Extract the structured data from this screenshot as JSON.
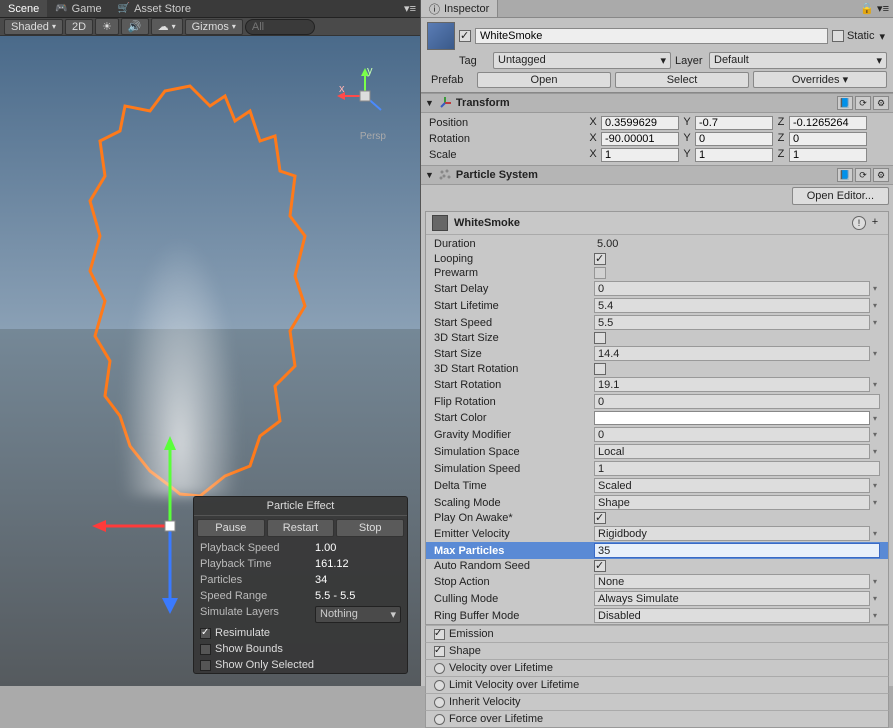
{
  "tabs": {
    "scene": "Scene",
    "game": "Game",
    "asset_store": "Asset Store"
  },
  "scene_toolbar": {
    "shading": "Shaded",
    "view2d": "2D",
    "gizmos": "Gizmos",
    "search_placeholder": "All"
  },
  "persp": "Persp",
  "particle_effect": {
    "title": "Particle Effect",
    "pause_btn": "Pause",
    "restart_btn": "Restart",
    "stop_btn": "Stop",
    "playback_speed_lbl": "Playback Speed",
    "playback_speed_val": "1.00",
    "playback_time_lbl": "Playback Time",
    "playback_time_val": "161.12",
    "particles_lbl": "Particles",
    "particles_val": "34",
    "speed_range_lbl": "Speed Range",
    "speed_range_val": "5.5 - 5.5",
    "simulate_layers_lbl": "Simulate Layers",
    "simulate_layers_val": "Nothing",
    "resimulate_lbl": "Resimulate",
    "show_bounds_lbl": "Show Bounds",
    "show_only_sel_lbl": "Show Only Selected"
  },
  "inspector": {
    "tab": "Inspector",
    "name": "WhiteSmoke",
    "static_lbl": "Static",
    "tag_lbl": "Tag",
    "tag_val": "Untagged",
    "layer_lbl": "Layer",
    "layer_val": "Default",
    "prefab_lbl": "Prefab",
    "prefab_open": "Open",
    "prefab_select": "Select",
    "prefab_overrides": "Overrides"
  },
  "transform": {
    "title": "Transform",
    "position_lbl": "Position",
    "pos_x": "0.3599629",
    "pos_y": "-0.7",
    "pos_z": "-0.1265264",
    "rotation_lbl": "Rotation",
    "rot_x": "-90.00001",
    "rot_y": "0",
    "rot_z": "0",
    "scale_lbl": "Scale",
    "scl_x": "1",
    "scl_y": "1",
    "scl_z": "1"
  },
  "ps": {
    "title": "Particle System",
    "open_editor": "Open Editor...",
    "module_name": "WhiteSmoke",
    "props": {
      "duration_lbl": "Duration",
      "duration_val": "5.00",
      "looping_lbl": "Looping",
      "prewarm_lbl": "Prewarm",
      "start_delay_lbl": "Start Delay",
      "start_delay_val": "0",
      "start_lifetime_lbl": "Start Lifetime",
      "start_lifetime_val": "5.4",
      "start_speed_lbl": "Start Speed",
      "start_speed_val": "5.5",
      "start_size3d_lbl": "3D Start Size",
      "start_size_lbl": "Start Size",
      "start_size_val": "14.4",
      "start_rot3d_lbl": "3D Start Rotation",
      "start_rot_lbl": "Start Rotation",
      "start_rot_val": "19.1",
      "flip_rot_lbl": "Flip Rotation",
      "flip_rot_val": "0",
      "start_color_lbl": "Start Color",
      "gravity_lbl": "Gravity Modifier",
      "gravity_val": "0",
      "sim_space_lbl": "Simulation Space",
      "sim_space_val": "Local",
      "sim_speed_lbl": "Simulation Speed",
      "sim_speed_val": "1",
      "delta_time_lbl": "Delta Time",
      "delta_time_val": "Scaled",
      "scaling_mode_lbl": "Scaling Mode",
      "scaling_mode_val": "Shape",
      "play_on_awake_lbl": "Play On Awake*",
      "emitter_vel_lbl": "Emitter Velocity",
      "emitter_vel_val": "Rigidbody",
      "max_particles_lbl": "Max Particles",
      "max_particles_val": "35",
      "auto_seed_lbl": "Auto Random Seed",
      "stop_action_lbl": "Stop Action",
      "stop_action_val": "None",
      "culling_mode_lbl": "Culling Mode",
      "culling_mode_val": "Always Simulate",
      "ring_buffer_lbl": "Ring Buffer Mode",
      "ring_buffer_val": "Disabled"
    },
    "modules": {
      "emission": "Emission",
      "shape": "Shape",
      "vol": "Velocity over Lifetime",
      "lvol": "Limit Velocity over Lifetime",
      "inherit_vel": "Inherit Velocity",
      "fol": "Force over Lifetime"
    }
  },
  "axis": {
    "x": "X",
    "y": "Y",
    "z": "Z"
  }
}
